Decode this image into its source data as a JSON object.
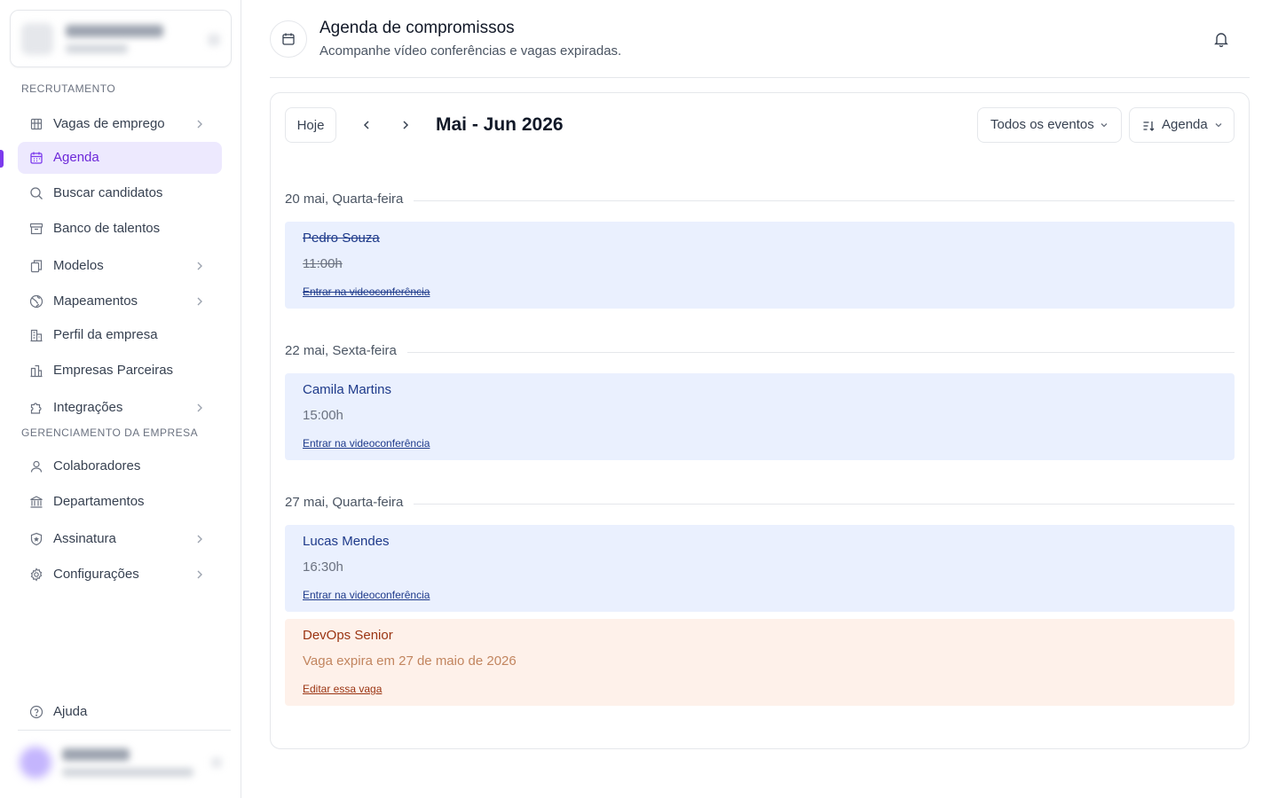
{
  "sidebar": {
    "sections": [
      {
        "title": "RECRUTAMENTO"
      },
      {
        "title": "GERENCIAMENTO DA EMPRESA"
      }
    ],
    "items": [
      {
        "label": "Vagas de emprego",
        "icon": "building-icon",
        "chevron": true
      },
      {
        "label": "Agenda",
        "icon": "calendar-icon",
        "active": true
      },
      {
        "label": "Buscar candidatos",
        "icon": "search-icon"
      },
      {
        "label": "Banco de talentos",
        "icon": "archive-icon"
      },
      {
        "label": "Modelos",
        "icon": "copy-icon",
        "chevron": true
      },
      {
        "label": "Mapeamentos",
        "icon": "globe-icon",
        "chevron": true
      },
      {
        "label": "Perfil da empresa",
        "icon": "company-icon"
      },
      {
        "label": "Empresas Parceiras",
        "icon": "partner-building-icon"
      },
      {
        "label": "Integrações",
        "icon": "puzzle-icon",
        "chevron": true
      },
      {
        "label": "Colaboradores",
        "icon": "user-icon"
      },
      {
        "label": "Departamentos",
        "icon": "bank-icon"
      },
      {
        "label": "Assinatura",
        "icon": "shield-icon",
        "chevron": true
      },
      {
        "label": "Configurações",
        "icon": "gear-icon",
        "chevron": true
      }
    ],
    "help": {
      "label": "Ajuda",
      "icon": "help-circle-icon"
    }
  },
  "header": {
    "title": "Agenda de compromissos",
    "subtitle": "Acompanhe vídeo conferências e vagas expiradas.",
    "icon": "calendar-icon"
  },
  "toolbar": {
    "today_label": "Hoje",
    "month_label": "Mai - Jun 2026",
    "filter_label": "Todos os eventos",
    "view_label": "Agenda"
  },
  "days": [
    {
      "label": "20 mai, Quarta-feira",
      "events": [
        {
          "type": "video",
          "name": "Pedro Souza",
          "time": "11:00h",
          "link": "Entrar na videoconferência",
          "struck": true
        }
      ]
    },
    {
      "label": "22 mai, Sexta-feira",
      "events": [
        {
          "type": "video",
          "name": "Camila Martins",
          "time": "15:00h",
          "link": "Entrar na videoconferência",
          "struck": false
        }
      ]
    },
    {
      "label": "27 mai, Quarta-feira",
      "events": [
        {
          "type": "video",
          "name": "Lucas Mendes",
          "time": "16:30h",
          "link": "Entrar na videoconferência",
          "struck": false
        },
        {
          "type": "job",
          "name": "DevOps Senior",
          "time": "Vaga expira em 27 de maio de 2026",
          "link": "Editar essa vaga",
          "struck": false
        }
      ]
    }
  ],
  "colors": {
    "accent": "#7c3aed",
    "active_bg": "#ede9fe",
    "video_event_bg": "#eaf0fe",
    "job_event_bg": "#fef1ea"
  }
}
